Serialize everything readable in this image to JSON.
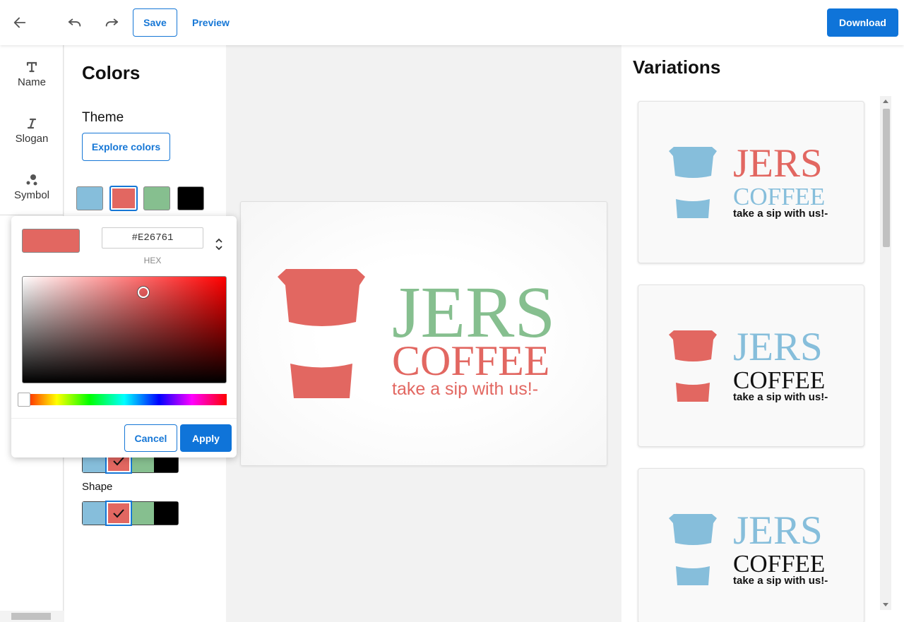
{
  "toolbar": {
    "save_label": "Save",
    "preview_label": "Preview",
    "download_label": "Download"
  },
  "rail": {
    "items": [
      {
        "label": "Name",
        "icon": "text-t-icon"
      },
      {
        "label": "Slogan",
        "icon": "italic-i-icon"
      },
      {
        "label": "Symbol",
        "icon": "shapes-icon"
      }
    ]
  },
  "panel": {
    "title": "Colors",
    "theme_label": "Theme",
    "explore_label": "Explore colors",
    "shape_label": "Shape"
  },
  "palette": [
    "#86BEDB",
    "#E26761",
    "#86BF8F",
    "#000000"
  ],
  "picker": {
    "hex_value": "#E26761",
    "hex_label": "HEX",
    "cancel_label": "Cancel",
    "apply_label": "Apply"
  },
  "logo": {
    "name": "JERS",
    "word": "COFFEE",
    "slogan": "take a sip with us!-"
  },
  "variations": {
    "title": "Variations"
  },
  "colors": {
    "accent": "#1677D6",
    "red": "#E26761",
    "green": "#86BF8F",
    "blue": "#86BEDB"
  }
}
